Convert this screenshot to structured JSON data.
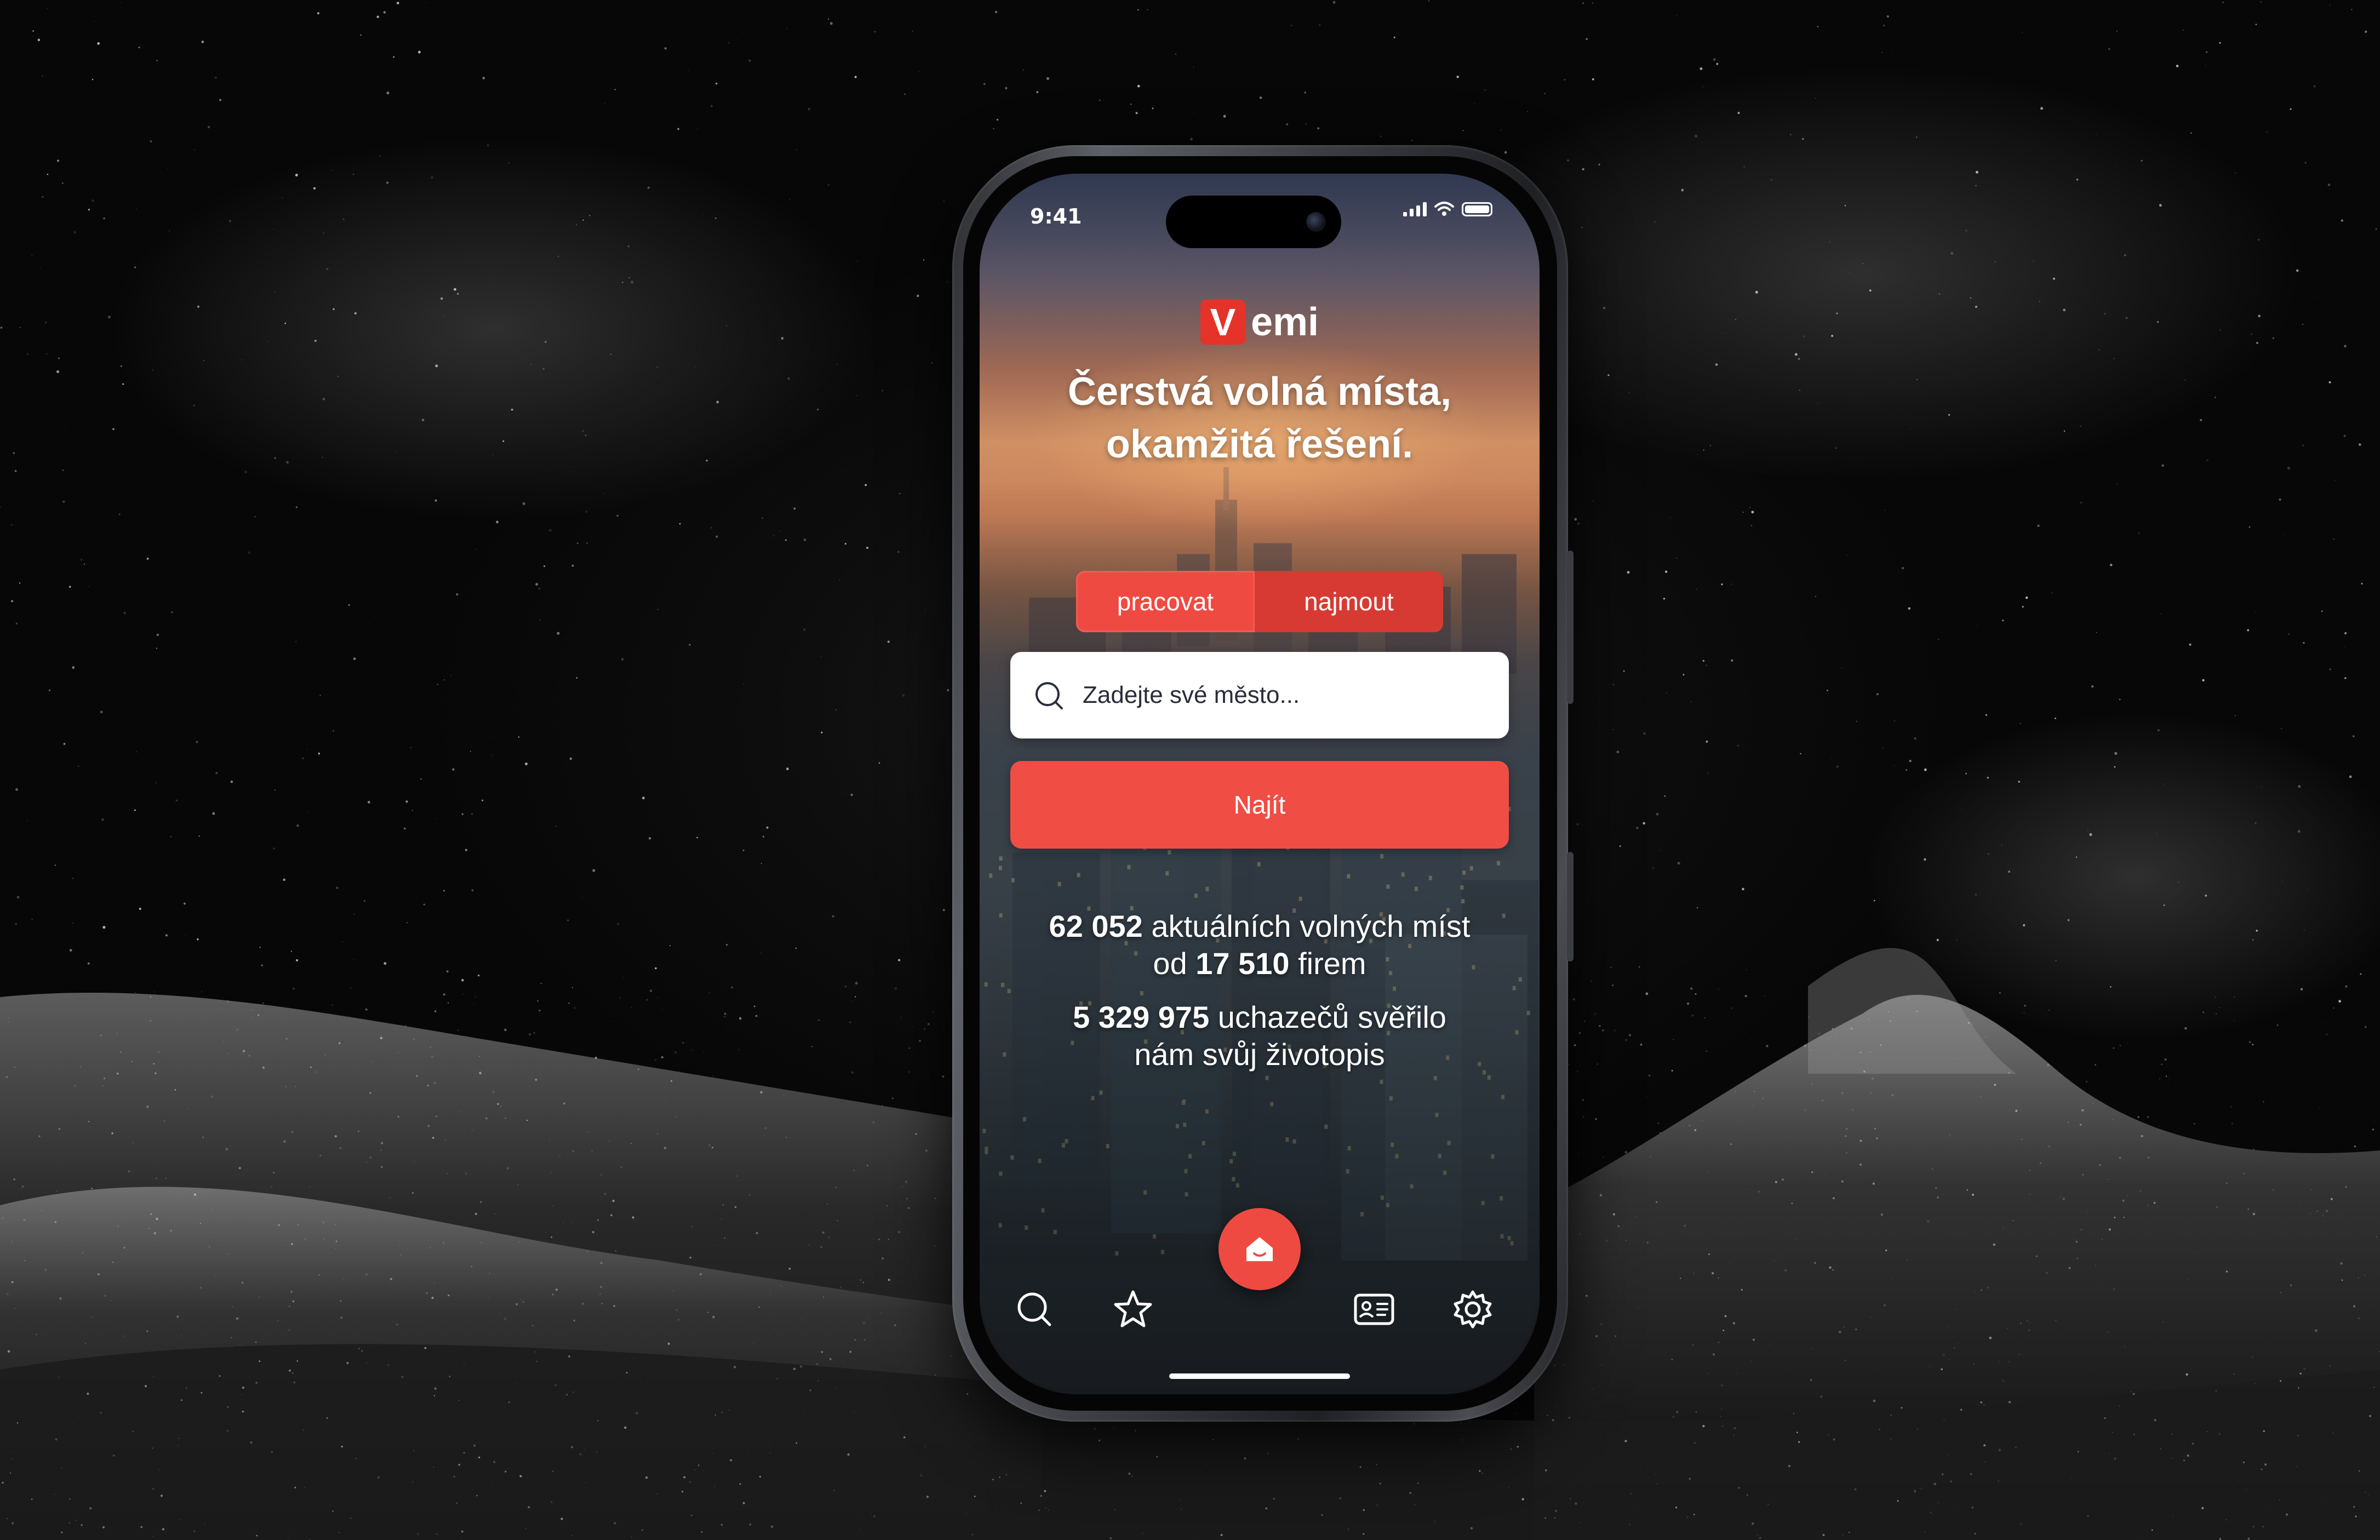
{
  "status_bar": {
    "time": "9:41"
  },
  "brand": {
    "logo_mark": "V",
    "logo_text": "emi"
  },
  "headline": {
    "line1": "Čerstvá volná místa,",
    "line2": "okamžitá řešení."
  },
  "mode_tabs": [
    {
      "label": "pracovat",
      "selected": true
    },
    {
      "label": "najmout",
      "selected": false
    }
  ],
  "search": {
    "placeholder": "Zadejte své město...",
    "value": "",
    "icon": "search-icon"
  },
  "find_button": {
    "label": "Najít"
  },
  "stats": {
    "jobs_count": "62 052",
    "jobs_text": "aktuálních volných míst",
    "firms_prefix": "od",
    "firms_count": "17 510",
    "firms_text": "firem",
    "applicants_count": "5 329 975",
    "applicants_text": "uchazečů svěřilo",
    "applicants_text2": "nám svůj životopis"
  },
  "tab_bar": {
    "items": [
      {
        "name": "search",
        "icon": "search-icon"
      },
      {
        "name": "favorites",
        "icon": "star-icon"
      },
      {
        "name": "home",
        "icon": "home-icon",
        "active": true
      },
      {
        "name": "cv",
        "icon": "id-card-icon"
      },
      {
        "name": "settings",
        "icon": "gear-icon"
      }
    ]
  },
  "colors": {
    "accent": "#ef4a42",
    "accent_dark": "#d73a33",
    "text_on_accent": "#ffffff",
    "input_text": "#2a2d3a"
  }
}
